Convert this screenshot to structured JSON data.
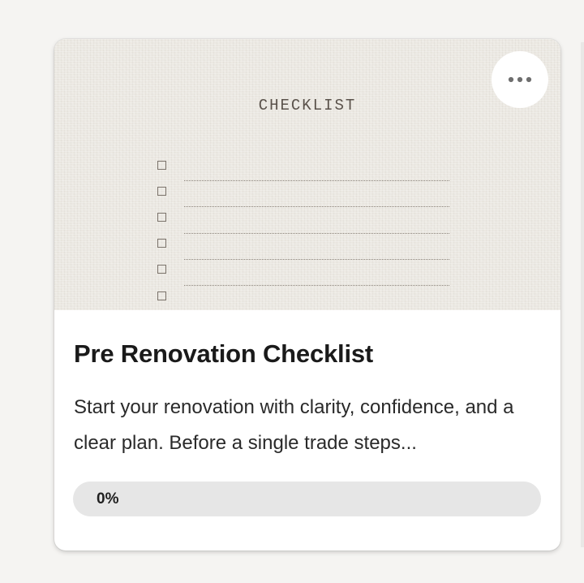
{
  "card": {
    "cover_title": "CHECKLIST",
    "checklist_rows": 6,
    "more_icon": "more-horizontal-icon",
    "title": "Pre Renovation Checklist",
    "description": "Start your renovation with clarity, confidence, and a clear plan. Before a single trade steps...",
    "progress": {
      "label": "0%",
      "value_percent": 0
    }
  },
  "colors": {
    "card_background": "#ffffff",
    "page_background": "#f5f4f2",
    "cover_background": "#ebe8e2",
    "progress_track": "#e6e6e6",
    "title_text": "#1a1a1a"
  }
}
